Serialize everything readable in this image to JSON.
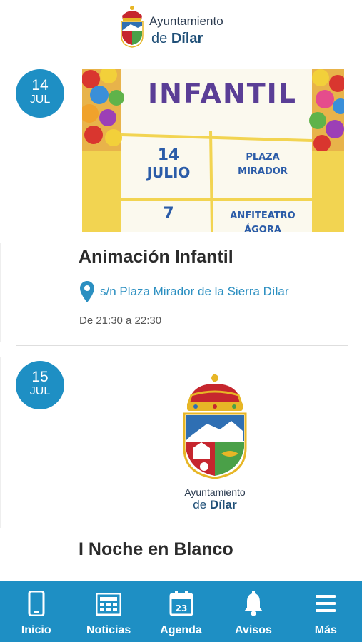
{
  "header": {
    "logo_line1": "Ayuntamiento",
    "logo_line2_prefix": "de ",
    "logo_line2_name": "Dílar"
  },
  "events": [
    {
      "day": "14",
      "month": "JUL",
      "poster": {
        "heading": "INFANTIL",
        "cell1_line1": "14",
        "cell1_line2": "JULIO",
        "cell2_line1": "PLAZA",
        "cell2_line2": "MIRADOR",
        "cell3": "7",
        "cell4_line1": "ANFITEATRO",
        "cell4_line2": "ÁGORA"
      },
      "title": "Animación Infantil",
      "location": "s/n Plaza Mirador de la Sierra Dílar",
      "time": "De 21:30 a 22:30"
    },
    {
      "day": "15",
      "month": "JUL",
      "logo_line1": "Ayuntamiento",
      "logo_line2_prefix": "de ",
      "logo_line2_name": "Dílar",
      "title": "I Noche en Blanco"
    }
  ],
  "nav": {
    "items": [
      {
        "label": "Inicio",
        "icon": "phone-icon"
      },
      {
        "label": "Noticias",
        "icon": "newspaper-icon"
      },
      {
        "label": "Agenda",
        "icon": "calendar-icon",
        "calendar_day": "23"
      },
      {
        "label": "Avisos",
        "icon": "bell-icon"
      },
      {
        "label": "Más",
        "icon": "menu-icon"
      }
    ]
  },
  "colors": {
    "accent": "#1e8fc4",
    "title": "#2b2b2b",
    "location": "#2b8fc1"
  }
}
